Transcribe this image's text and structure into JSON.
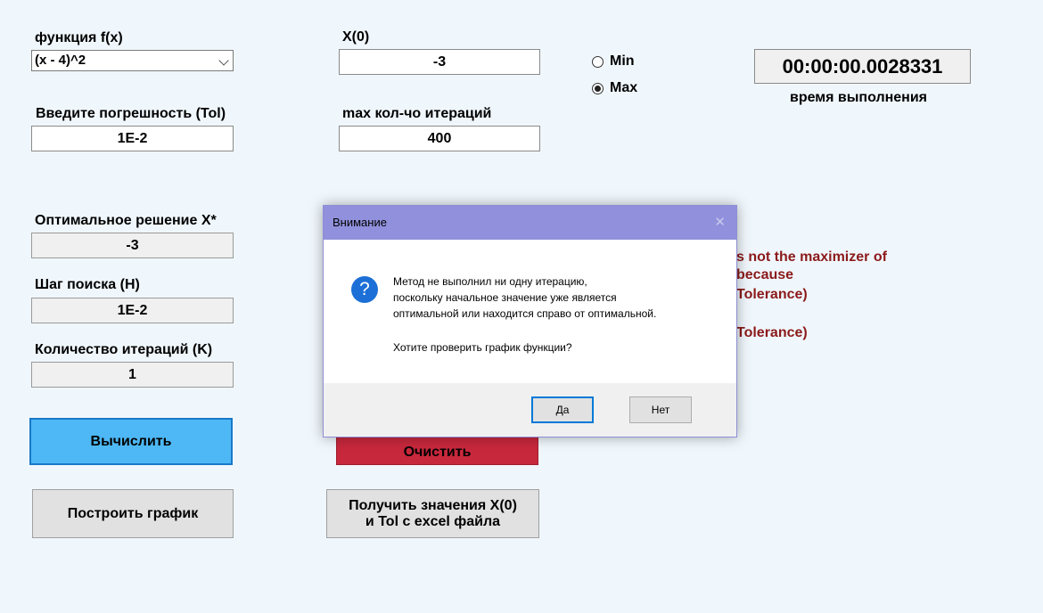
{
  "form": {
    "function_label": "функция f(x)",
    "function_value": "(x - 4)^2",
    "x0_label": "X(0)",
    "x0_value": "-3",
    "tol_label": "Введите погрешность (Tol)",
    "tol_value": "1E-2",
    "maxiter_label": "max кол-чо итераций",
    "maxiter_value": "400",
    "radio_min": "Min",
    "radio_max": "Max",
    "radio_selected": "Max",
    "timer_value": "00:00:00.0028331",
    "timer_label": "время выполнения"
  },
  "results": {
    "optimal_label": "Оптимальное решение X*",
    "optimal_value": "-3",
    "step_label": "Шаг поиска (H)",
    "step_value": "1E-2",
    "iter_label": "Количество итераций (K)",
    "iter_value": "1"
  },
  "buttons": {
    "calculate": "Вычислить",
    "clear": "Очистить",
    "plot": "Построить график",
    "excel_line1": "Получить значения X(0)",
    "excel_line2": "и Tol с excel файла"
  },
  "error_text": {
    "line1": "s not the maximizer of",
    "line2": "because",
    "line3": "Tolerance)",
    "line4": "Tolerance)"
  },
  "dialog": {
    "title": "Внимание",
    "close_glyph": "✕",
    "icon_glyph": "?",
    "msg_line1": "Метод не выполнил ни одну итерацию,",
    "msg_line2": "поскольку начальное значение уже является",
    "msg_line3": "оптимальной или находится справо от оптимальной.",
    "question": "Хотите проверить график функции?",
    "yes": "Да",
    "no": "Нет"
  },
  "colors": {
    "background": "#f0f7fc",
    "calc_button": "#4db8f5",
    "clear_button": "#c8283c",
    "error_text": "#8b1a1a",
    "dialog_title": "#9090dc"
  }
}
